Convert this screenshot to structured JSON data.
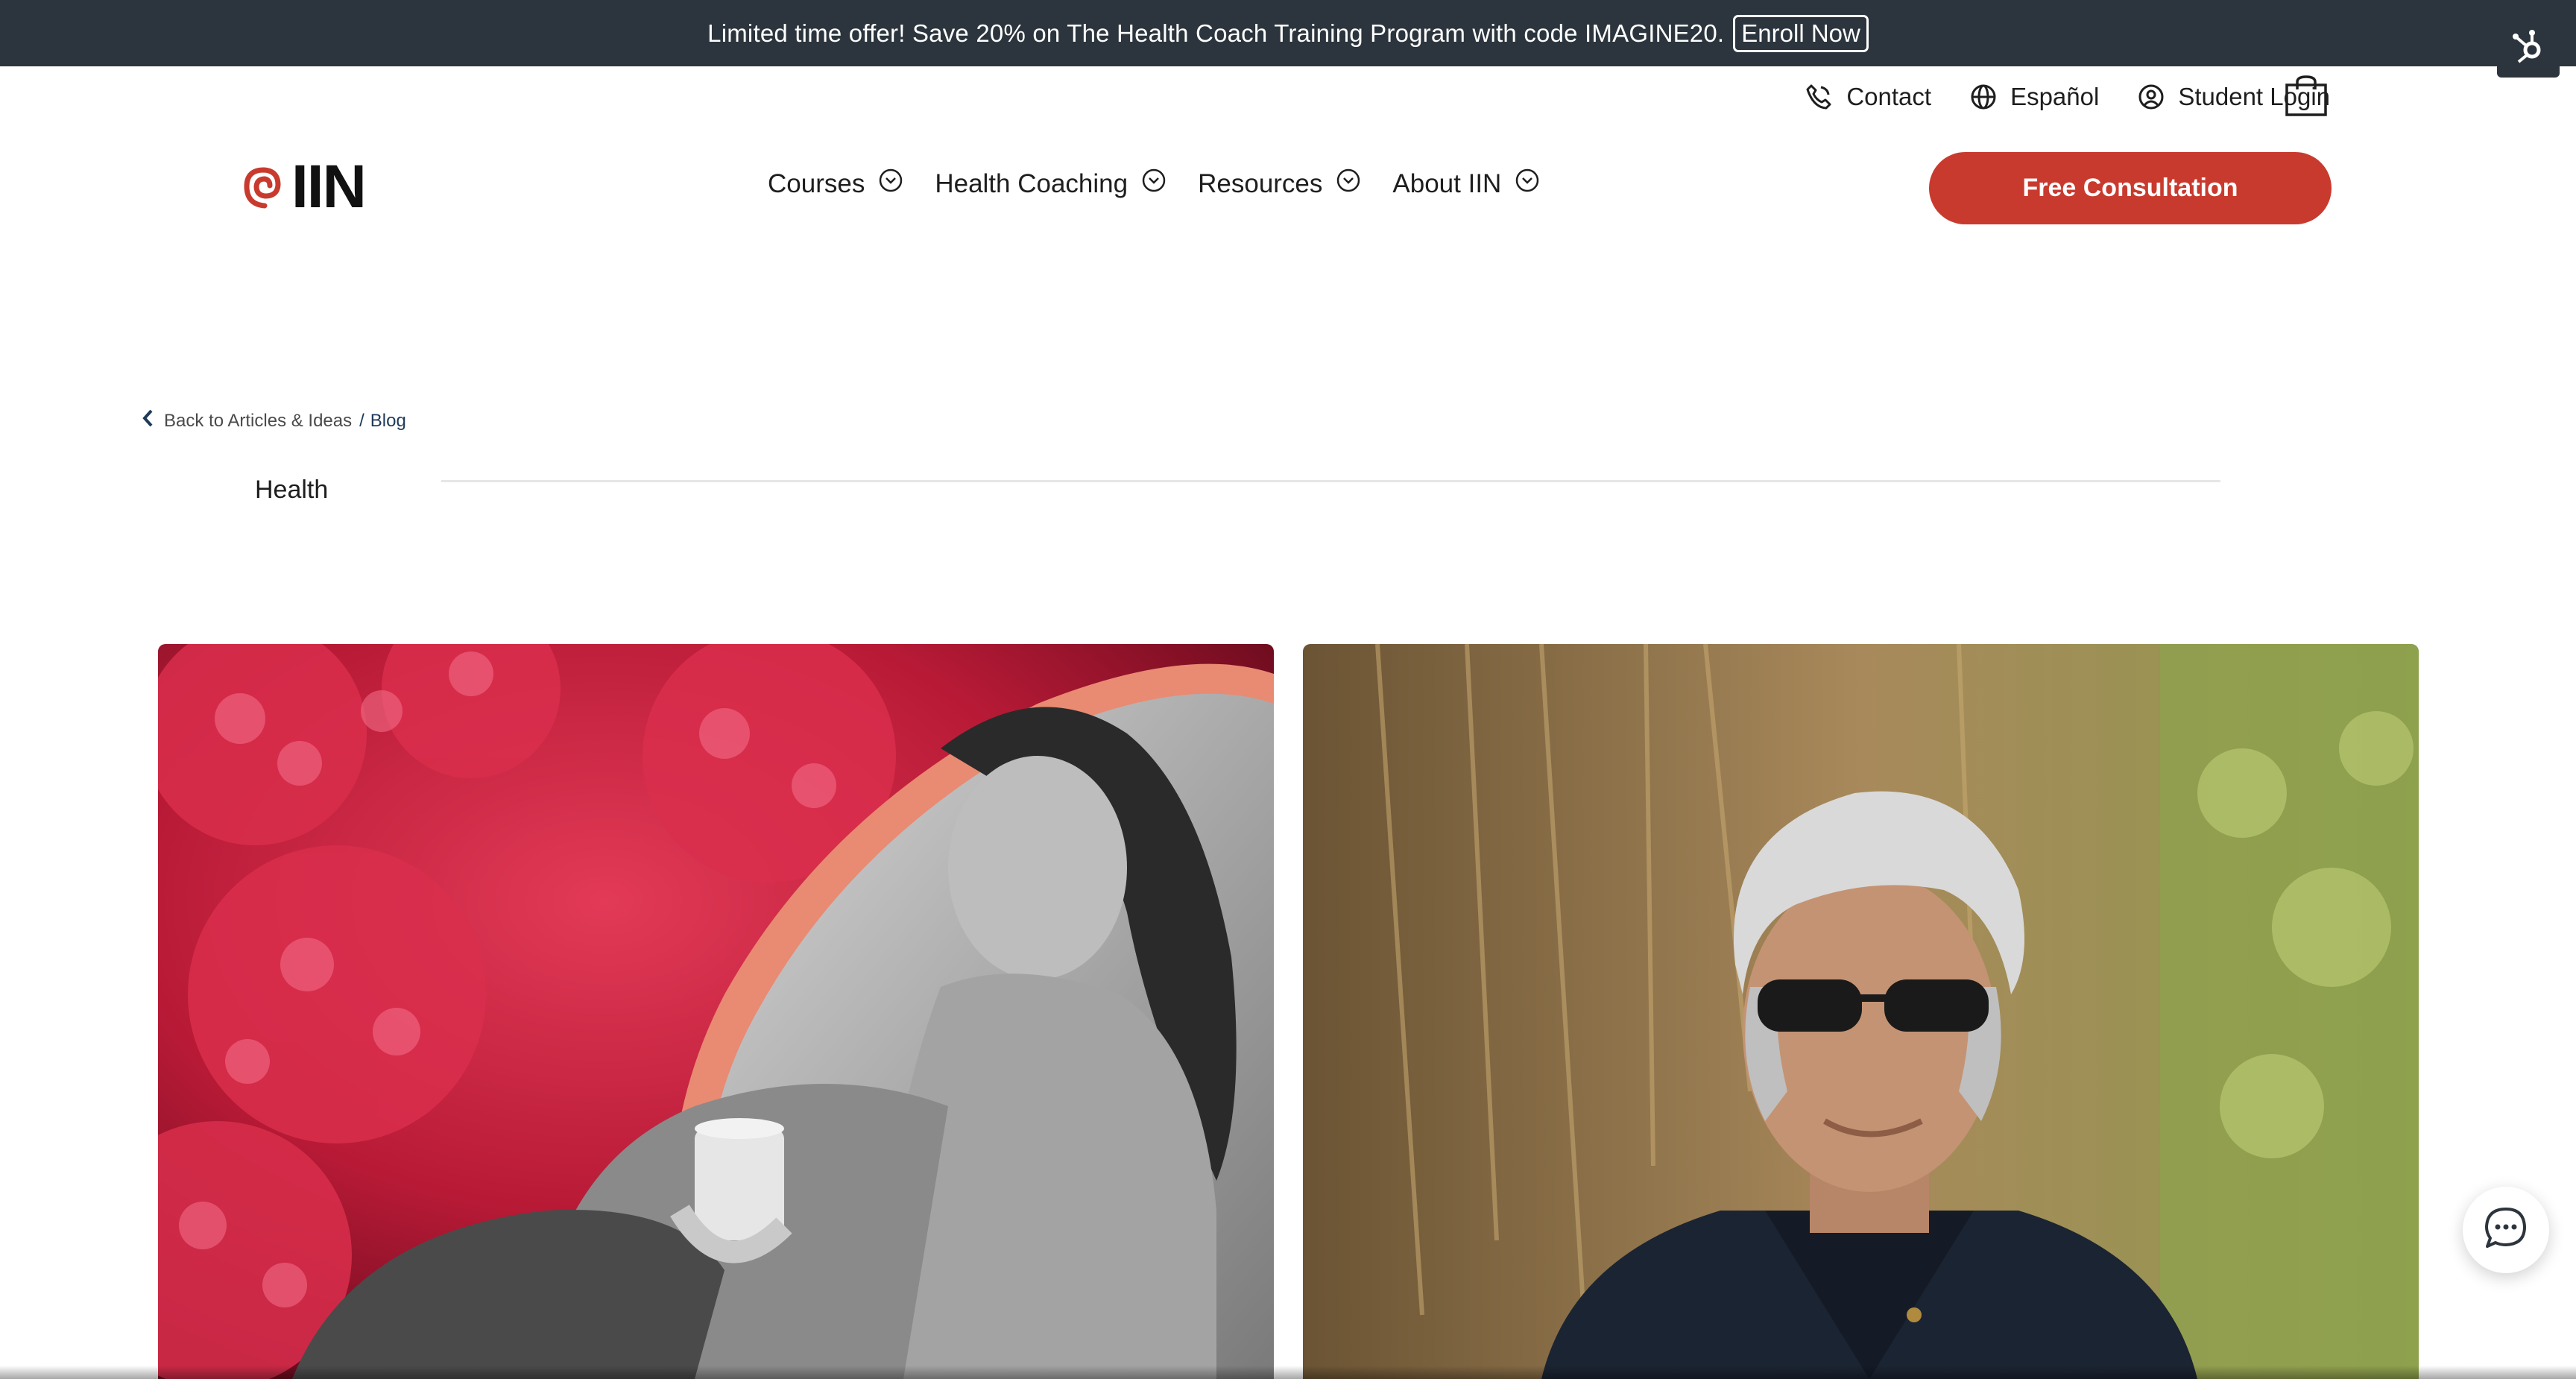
{
  "promo": {
    "text": "Limited time offer! Save 20% on The Health Coach Training Program with code IMAGINE20.",
    "button": "Enroll Now"
  },
  "utility_nav": {
    "contact": "Contact",
    "language": "Español",
    "login": "Student Login"
  },
  "logo": {
    "text": "IIN"
  },
  "main_nav": [
    {
      "label": "Courses"
    },
    {
      "label": "Health Coaching"
    },
    {
      "label": "Resources"
    },
    {
      "label": "About IIN"
    }
  ],
  "cta": {
    "label": "Free Consultation"
  },
  "breadcrumb": {
    "back": "Back to Articles & Ideas",
    "separator": "/",
    "current": "Blog"
  },
  "category": {
    "label": "Health"
  },
  "colors": {
    "promo_bg": "#2c353d",
    "accent": "#c93a2e",
    "breadcrumb_link": "#1d3a5a"
  }
}
